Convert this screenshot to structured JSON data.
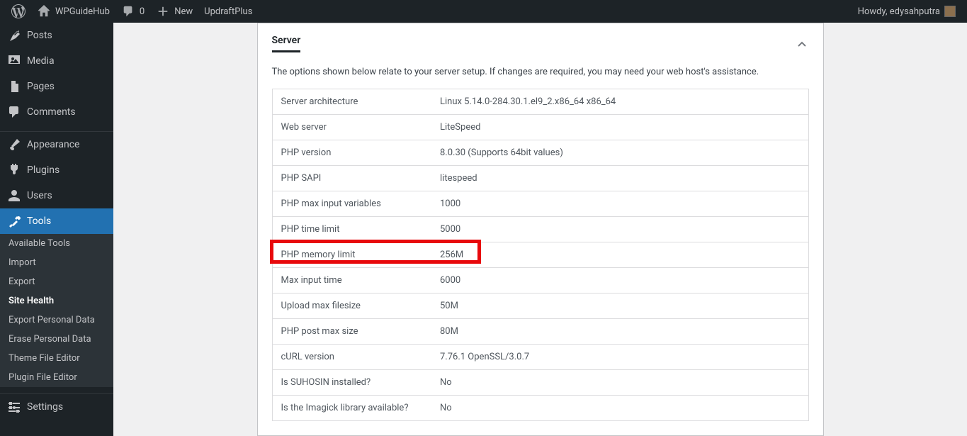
{
  "adminbar": {
    "site_name": "WPGuideHub",
    "comments_count": "0",
    "new_label": "New",
    "updraft_label": "UpdraftPlus",
    "howdy": "Howdy, edysahputra"
  },
  "sidebar": {
    "posts": "Posts",
    "media": "Media",
    "pages": "Pages",
    "comments": "Comments",
    "appearance": "Appearance",
    "plugins": "Plugins",
    "users": "Users",
    "tools": "Tools",
    "settings": "Settings",
    "tools_sub": {
      "available": "Available Tools",
      "import": "Import",
      "export": "Export",
      "site_health": "Site Health",
      "export_pd": "Export Personal Data",
      "erase_pd": "Erase Personal Data",
      "theme_editor": "Theme File Editor",
      "plugin_editor": "Plugin File Editor"
    }
  },
  "panel": {
    "title": "Server",
    "description": "The options shown below relate to your server setup. If changes are required, you may need your web host's assistance.",
    "rows": [
      {
        "label": "Server architecture",
        "value": "Linux 5.14.0-284.30.1.el9_2.x86_64 x86_64"
      },
      {
        "label": "Web server",
        "value": "LiteSpeed"
      },
      {
        "label": "PHP version",
        "value": "8.0.30 (Supports 64bit values)"
      },
      {
        "label": "PHP SAPI",
        "value": "litespeed"
      },
      {
        "label": "PHP max input variables",
        "value": "1000"
      },
      {
        "label": "PHP time limit",
        "value": "5000"
      },
      {
        "label": "PHP memory limit",
        "value": "256M"
      },
      {
        "label": "Max input time",
        "value": "6000"
      },
      {
        "label": "Upload max filesize",
        "value": "50M"
      },
      {
        "label": "PHP post max size",
        "value": "80M"
      },
      {
        "label": "cURL version",
        "value": "7.76.1 OpenSSL/3.0.7"
      },
      {
        "label": "Is SUHOSIN installed?",
        "value": "No"
      },
      {
        "label": "Is the Imagick library available?",
        "value": "No"
      }
    ]
  }
}
